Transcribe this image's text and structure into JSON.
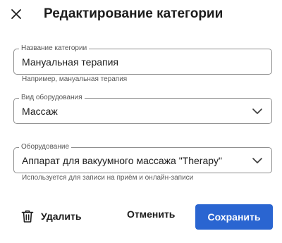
{
  "dialog": {
    "title": "Редактирование категории"
  },
  "fields": {
    "category_name": {
      "label": "Название категории",
      "value": "Мануальная терапия",
      "helper": "Например, мануальная терапия"
    },
    "equipment_type": {
      "label": "Вид оборудования",
      "value": "Массаж"
    },
    "equipment": {
      "label": "Оборудование",
      "value": "Аппарат для вакуумного массажа \"Therapy\"",
      "helper": "Используется для записи на приём и онлайн-записи"
    }
  },
  "actions": {
    "delete_label": "Удалить",
    "cancel_label": "Отменить",
    "save_label": "Сохранить"
  },
  "icons": {
    "close": "close-icon",
    "trash": "trash-icon",
    "chevron": "chevron-down-icon"
  },
  "colors": {
    "primary": "#2a65d1",
    "border": "#8e8e8e",
    "text": "#1c1c1c"
  }
}
